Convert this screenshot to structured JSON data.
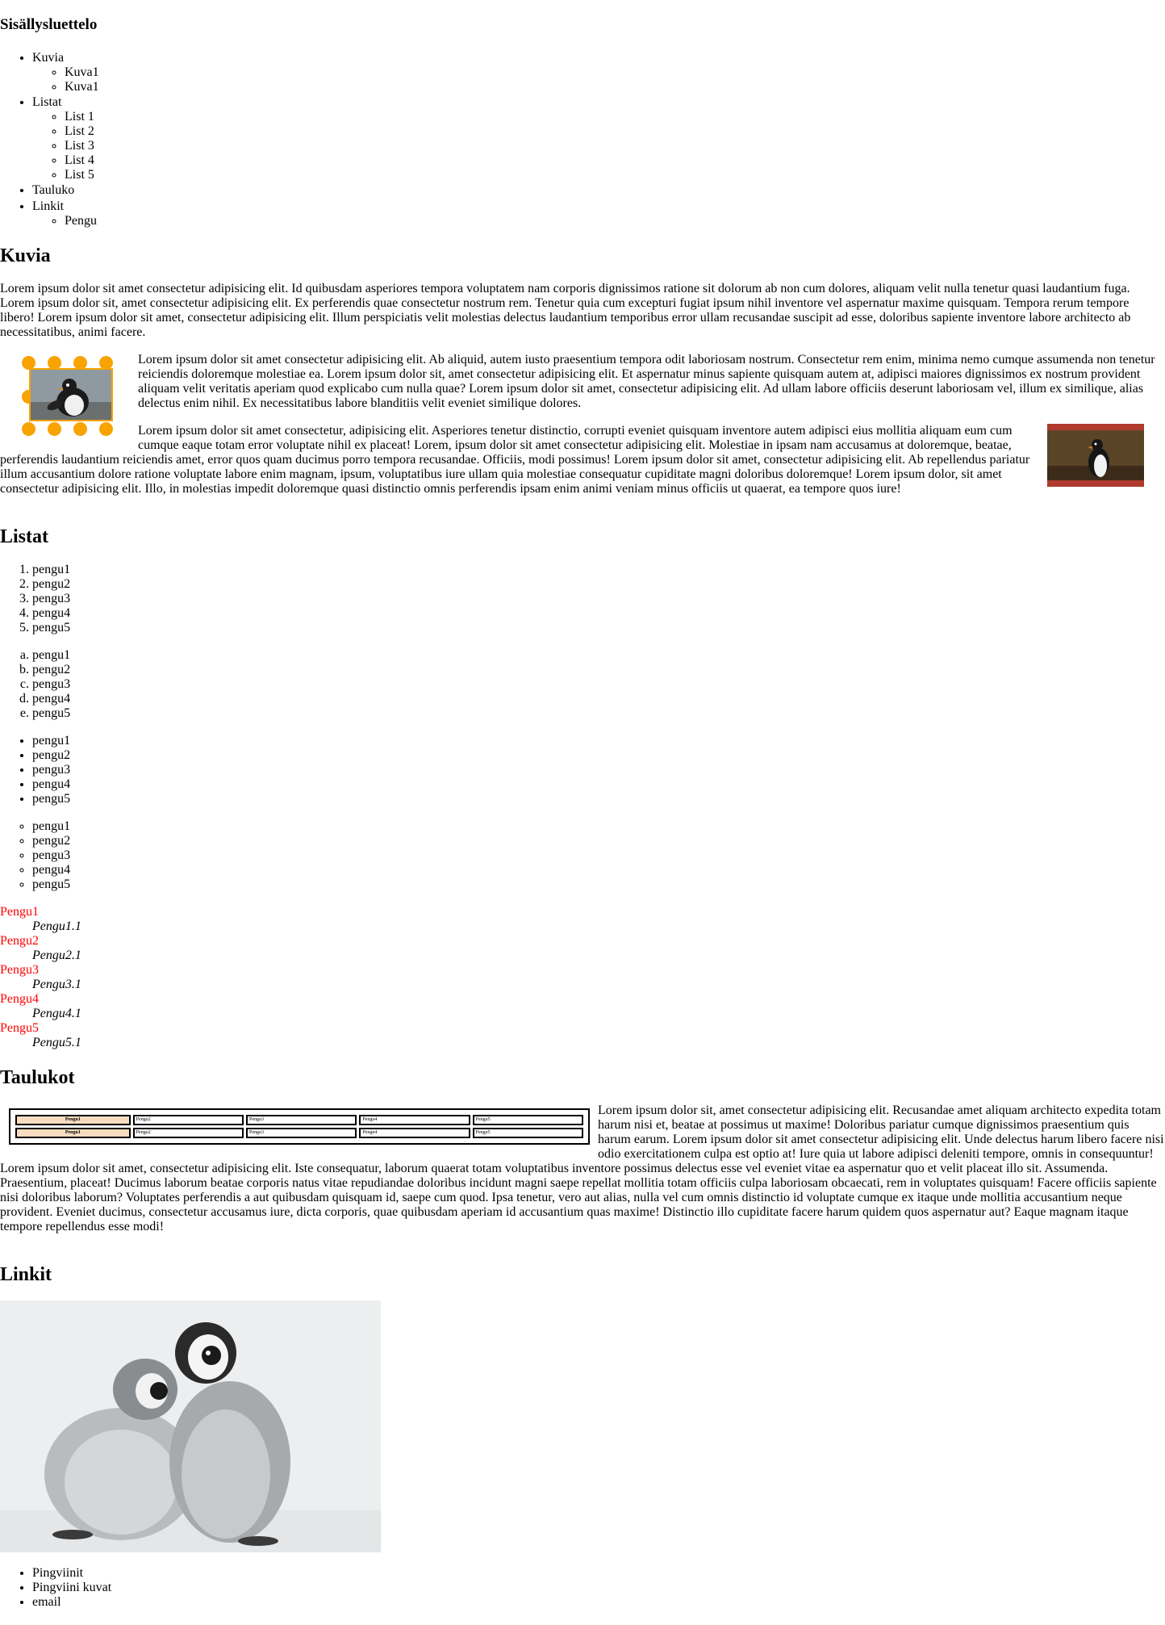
{
  "toc": {
    "title": "Sisällysluettelo",
    "items": [
      {
        "label": "Kuvia",
        "children": [
          "Kuva1",
          "Kuva1"
        ]
      },
      {
        "label": "Listat",
        "children": [
          "List 1",
          "List 2",
          "List 3",
          "List 4",
          "List 5"
        ]
      },
      {
        "label": "Tauluko",
        "children": []
      },
      {
        "label": "Linkit",
        "children": [
          "Pengu"
        ]
      }
    ]
  },
  "kuvia": {
    "heading": "Kuvia",
    "p1": "Lorem ipsum dolor sit amet consectetur adipisicing elit. Id quibusdam asperiores tempora voluptatem nam corporis dignissimos ratione sit dolorum ab non cum dolores, aliquam velit nulla tenetur quasi laudantium fuga. Lorem ipsum dolor sit, amet consectetur adipisicing elit. Ex perferendis quae consectetur nostrum rem. Tenetur quia cum excepturi fugiat ipsum nihil inventore vel aspernatur maxime quisquam. Tempora rerum tempore libero! Lorem ipsum dolor sit amet, consectetur adipisicing elit. Illum perspiciatis velit molestias delectus laudantium temporibus error ullam recusandae suscipit ad esse, doloribus sapiente inventore labore architecto ab necessitatibus, animi facere.",
    "p2": "Lorem ipsum dolor sit amet consectetur adipisicing elit. Ab aliquid, autem iusto praesentium tempora odit laboriosam nostrum. Consectetur rem enim, minima nemo cumque assumenda non tenetur reiciendis doloremque molestiae ea. Lorem ipsum dolor sit, amet consectetur adipisicing elit. Et aspernatur minus sapiente quisquam autem at, adipisci maiores dignissimos ex nostrum provident aliquam velit veritatis aperiam quod explicabo cum nulla quae? Lorem ipsum dolor sit amet, consectetur adipisicing elit. Ad ullam labore officiis deserunt laboriosam vel, illum ex similique, alias delectus enim nihil. Ex necessitatibus labore blanditiis velit eveniet similique dolores.",
    "p3": "Lorem ipsum dolor sit amet consectetur, adipisicing elit. Asperiores tenetur distinctio, corrupti eveniet quisquam inventore autem adipisci eius mollitia aliquam eum cum cumque eaque totam error voluptate nihil ex placeat! Lorem, ipsum dolor sit amet consectetur adipisicing elit. Molestiae in ipsam nam accusamus at doloremque, beatae, perferendis laudantium reiciendis amet, error quos quam ducimus porro tempora recusandae. Officiis, modi possimus! Lorem ipsum dolor sit amet, consectetur adipisicing elit. Ab repellendus pariatur illum accusantium dolore ratione voluptate labore enim magnam, ipsum, voluptatibus iure ullam quia molestiae consequatur cupiditate magni doloribus doloremque! Lorem ipsum dolor, sit amet consectetur adipisicing elit. Illo, in molestias impedit doloremque quasi distinctio omnis perferendis ipsam enim animi veniam minus officiis ut quaerat, ea tempore quos iure!"
  },
  "listat": {
    "heading": "Listat",
    "ordered_decimal": [
      "pengu1",
      "pengu2",
      "pengu3",
      "pengu4",
      "pengu5"
    ],
    "ordered_alpha": [
      "pengu1",
      "pengu2",
      "pengu3",
      "pengu4",
      "pengu5"
    ],
    "unordered_disc": [
      "pengu1",
      "pengu2",
      "pengu3",
      "pengu4",
      "pengu5"
    ],
    "unordered_circle": [
      "pengu1",
      "pengu2",
      "pengu3",
      "pengu4",
      "pengu5"
    ],
    "definitions": [
      {
        "term": "Pengu1",
        "desc": "Pengu1.1"
      },
      {
        "term": "Pengu2",
        "desc": "Pengu2.1"
      },
      {
        "term": "Pengu3",
        "desc": "Pengu3.1"
      },
      {
        "term": "Pengu4",
        "desc": "Pengu4.1"
      },
      {
        "term": "Pengu5",
        "desc": "Pengu5.1"
      }
    ],
    "term_color": "#ff0000"
  },
  "taulukot": {
    "heading": "Taulukot",
    "rows": [
      [
        "Pengu1",
        "Pengu2",
        "Pengu3",
        "Pengu4",
        "Pengu5"
      ],
      [
        "Pengu1",
        "Pengu2",
        "Pengu3",
        "Pengu4",
        "Pengu5"
      ]
    ],
    "header_bg": "#f7dcc0",
    "paragraph": "Lorem ipsum dolor sit, amet consectetur adipisicing elit. Recusandae amet aliquam architecto expedita totam harum nisi et, beatae at possimus ut maxime! Doloribus pariatur cumque dignissimos praesentium quis harum earum. Lorem ipsum dolor sit amet consectetur adipisicing elit. Unde delectus harum libero facere nisi odio exercitationem culpa est optio at! Iure quia ut labore adipisci deleniti tempore, omnis in consequuntur! Lorem ipsum dolor sit amet, consectetur adipisicing elit. Iste consequatur, laborum quaerat totam voluptatibus inventore possimus delectus esse vel eveniet vitae ea aspernatur quo et velit placeat illo sit. Assumenda. Praesentium, placeat! Ducimus laborum beatae corporis natus vitae repudiandae doloribus incidunt magni saepe repellat mollitia totam officiis culpa laboriosam obcaecati, rem in voluptates quisquam! Facere officiis sapiente nisi doloribus laborum? Voluptates perferendis a aut quibusdam quisquam id, saepe cum quod. Ipsa tenetur, vero aut alias, nulla vel cum omnis distinctio id voluptate cumque ex itaque unde mollitia accusantium neque provident. Eveniet ducimus, consectetur accusamus iure, dicta corporis, quae quibusdam aperiam id accusantium quas maxime! Distinctio illo cupiditate facere harum quidem quos aspernatur aut? Eaque magnam itaque tempore repellendus esse modi!"
  },
  "linkit": {
    "heading": "Linkit",
    "links": [
      "Pingviinit",
      "Pingviini kuvat",
      "email"
    ]
  },
  "colors": {
    "ring_dots": "#f8a300",
    "red_frame": "#b03a2e"
  }
}
